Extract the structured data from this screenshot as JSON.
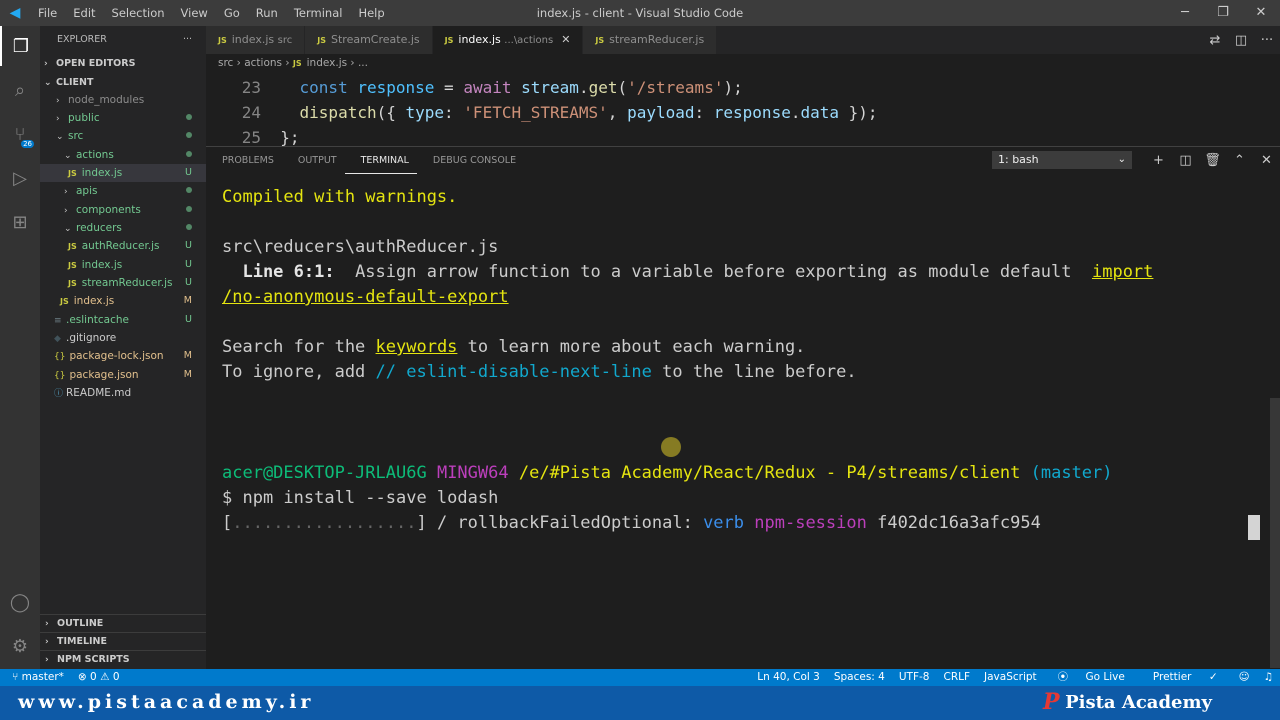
{
  "titlebar": {
    "menu": [
      "File",
      "Edit",
      "Selection",
      "View",
      "Go",
      "Run",
      "Terminal",
      "Help"
    ],
    "title": "index.js - client - Visual Studio Code"
  },
  "explorer": {
    "header": "EXPLORER",
    "open_editors": "OPEN EDITORS",
    "root": "CLIENT",
    "items": [
      {
        "label": "node_modules",
        "status": ""
      },
      {
        "label": "public",
        "status": "dot"
      },
      {
        "label": "src",
        "status": "dot"
      },
      {
        "label": "actions",
        "status": "dot"
      },
      {
        "label": "index.js",
        "status": "U"
      },
      {
        "label": "apis",
        "status": "dot"
      },
      {
        "label": "components",
        "status": "dot"
      },
      {
        "label": "reducers",
        "status": "dot"
      },
      {
        "label": "authReducer.js",
        "status": "U"
      },
      {
        "label": "index.js",
        "status": "U"
      },
      {
        "label": "streamReducer.js",
        "status": "U"
      },
      {
        "label": "index.js",
        "status": "M"
      },
      {
        "label": ".eslintcache",
        "status": "U"
      },
      {
        "label": ".gitignore",
        "status": ""
      },
      {
        "label": "package-lock.json",
        "status": "M"
      },
      {
        "label": "package.json",
        "status": "M"
      },
      {
        "label": "README.md",
        "status": ""
      }
    ],
    "outline": "OUTLINE",
    "timeline": "TIMELINE",
    "npm_scripts": "NPM SCRIPTS"
  },
  "tabs": [
    {
      "label": "index.js",
      "desc": "src"
    },
    {
      "label": "StreamCreate.js",
      "desc": ""
    },
    {
      "label": "index.js",
      "desc": "...\\actions"
    },
    {
      "label": "streamReducer.js",
      "desc": ""
    }
  ],
  "breadcrumb": {
    "a": "src",
    "b": "actions",
    "c": "index.js",
    "d": "..."
  },
  "code": {
    "lines": [
      {
        "n": "23"
      },
      {
        "n": "24"
      },
      {
        "n": "25"
      }
    ]
  },
  "panel": {
    "tabs": [
      "PROBLEMS",
      "OUTPUT",
      "TERMINAL",
      "DEBUG CONSOLE"
    ],
    "terminal_select": "1: bash"
  },
  "terminal": {
    "l1": "Compiled with warnings.",
    "l2": "src\\reducers\\authReducer.js",
    "l3a": "  Line 6:1:",
    "l3b": "  Assign arrow function to a variable before exporting as module default  ",
    "l3c": "import",
    "l4": "/no-anonymous-default-export",
    "l5a": "Search for the ",
    "l5b": "keywords",
    "l5c": " to learn more about each warning.",
    "l6a": "To ignore, add ",
    "l6b": "// eslint-disable-next-line",
    "l6c": " to the line before.",
    "p_user": "acer@DESKTOP-JRLAU6G",
    "p_sys": "MINGW64",
    "p_path": "/e/#Pista Academy/React/Redux - P4/streams/client",
    "p_branch": "(master)",
    "cmd": "$ npm install --save lodash",
    "prog_a": "[",
    "prog_b": "..................",
    "prog_c": "] / rollbackFailedOptional: ",
    "prog_d": "verb",
    "prog_e": "npm-session",
    "prog_f": " f402dc16a3afc954"
  },
  "status": {
    "branch": "master*",
    "problems": "⊗ 0 ⚠ 0",
    "right": [
      "Ln 40, Col 3",
      "Spaces: 4",
      "UTF-8",
      "CRLF",
      "JavaScript",
      "Go Live",
      "Prettier"
    ]
  },
  "footer": {
    "url": "www.pistaacademy.ir",
    "brand": "Pista Academy",
    "logo": "P"
  }
}
